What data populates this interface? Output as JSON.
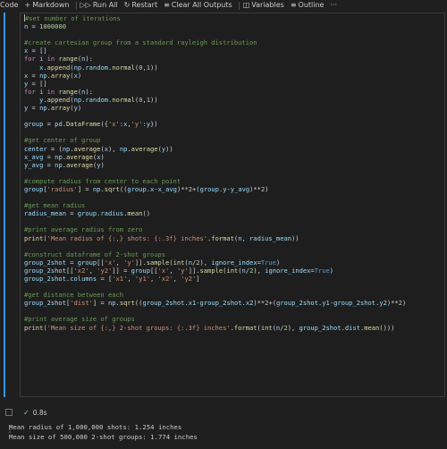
{
  "toolbar": {
    "code_label": "Code",
    "markdown_label": "Markdown",
    "run_all_label": "Run All",
    "restart_label": "Restart",
    "clear_all_label": "Clear All Outputs",
    "variables_label": "Variables",
    "outline_label": "Outline",
    "more_label": "···"
  },
  "cell": {
    "exec_time": "0.8s",
    "code_lines": [
      "#set number of iterations",
      "n = 1000000",
      "",
      "#create cartesian group from a standard rayleigh distribution",
      "x = []",
      "for i in range(n):",
      "    x.append(np.random.normal(0,1))",
      "x = np.array(x)",
      "y = []",
      "for i in range(n):",
      "    y.append(np.random.normal(0,1))",
      "y = np.array(y)",
      "",
      "group = pd.DataFrame({'x':x,'y':y})",
      "",
      "#get center of group",
      "center = (np.average(x), np.average(y))",
      "x_avg = np.average(x)",
      "y_avg = np.average(y)",
      "",
      "#compute radius from center to each point",
      "group['radius'] = np.sqrt((group.x-x_avg)**2+(group.y-y_avg)**2)",
      "",
      "#get mean radius",
      "radius_mean = group.radius.mean()",
      "",
      "#print average radius from zero",
      "print('Mean radius of {:,} shots: {:.3f} inches'.format(n, radius_mean))",
      "",
      "#construct dataframe of 2-shot groups",
      "group_2shot = group[['x', 'y']].sample(int(n/2), ignore_index=True)",
      "group_2shot[['x2', 'y2']] = group[['x', 'y']].sample(int(n/2), ignore_index=True)",
      "group_2shot.columns = ['x1', 'y1', 'x2', 'y2']",
      "",
      "#get distance between each",
      "group_2shot['dist'] = np.sqrt((group_2shot.x1-group_2shot.x2)**2+(group_2shot.y1-group_2shot.y2)**2)",
      "",
      "#print average size of groups",
      "print('Mean size of {:,} 2-shot groups: {:.3f} inches'.format(int(n/2), group_2shot.dist.mean()))"
    ]
  },
  "output": {
    "lines": [
      "Mean radius of 1,000,000 shots: 1.254 inches",
      "Mean size of 500,000 2-shot groups: 1.774 inches"
    ]
  }
}
